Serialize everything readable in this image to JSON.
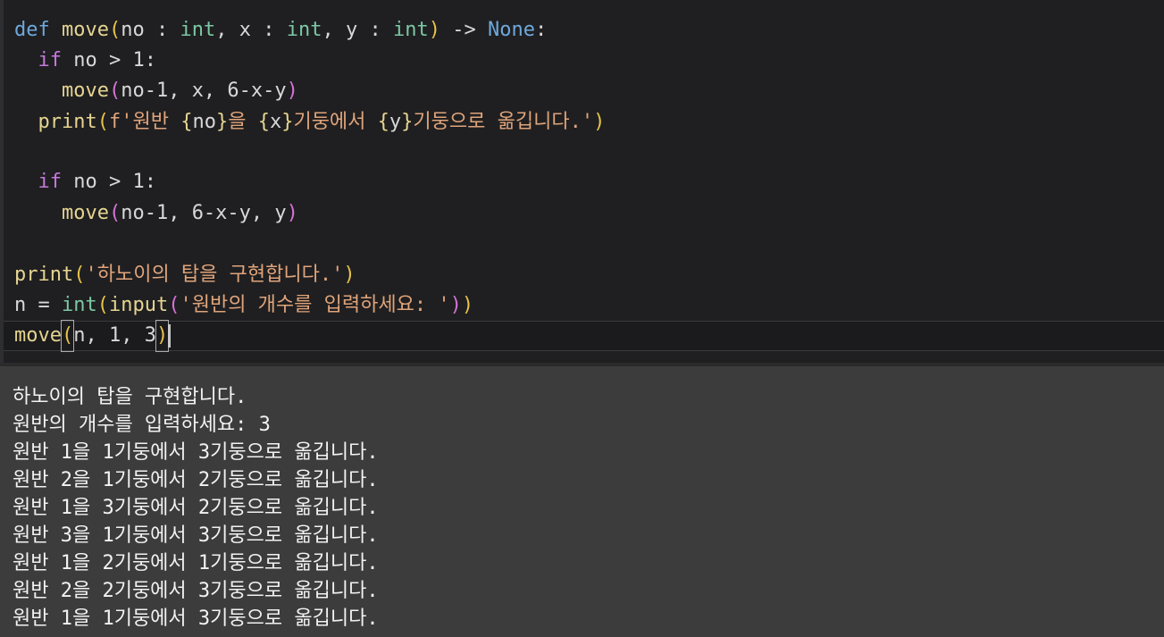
{
  "editor": {
    "tokens": {
      "def": "def",
      "move": "move",
      "no": "no",
      "int": "int",
      "x": "x",
      "y": "y",
      "none": "None",
      "if": "if",
      "print": "print",
      "input": "input",
      "n": "n"
    },
    "line1_params": " : ",
    "line1_arrow": " -> ",
    "line2_cond": " no > 1:",
    "line3_args": "no-1, x, 6-x-y",
    "line4_fprefix": "f'원반 ",
    "line4_mid1": "을 ",
    "line4_mid2": "기둥에서 ",
    "line4_mid3": "기둥으로 옮깁니다.'",
    "line7_args": "no-1, 6-x-y, y",
    "line9_str": "'하노이의 탑을 구현합니다.'",
    "line10_prefix": "n = ",
    "line10_str": "'원반의 개수를 입력하세요: '",
    "line11_args_a": "n, 1, 3"
  },
  "console": {
    "lines": [
      "하노이의 탑을 구현합니다.",
      "원반의 개수를 입력하세요: 3",
      "원반 1을 1기둥에서 3기둥으로 옮깁니다.",
      "원반 2을 1기둥에서 2기둥으로 옮깁니다.",
      "원반 1을 3기둥에서 2기둥으로 옮깁니다.",
      "원반 3을 1기둥에서 3기둥으로 옮깁니다.",
      "원반 1을 2기둥에서 1기둥으로 옮깁니다.",
      "원반 2을 2기둥에서 3기둥으로 옮깁니다.",
      "원반 1을 1기둥에서 3기둥으로 옮깁니다."
    ]
  }
}
